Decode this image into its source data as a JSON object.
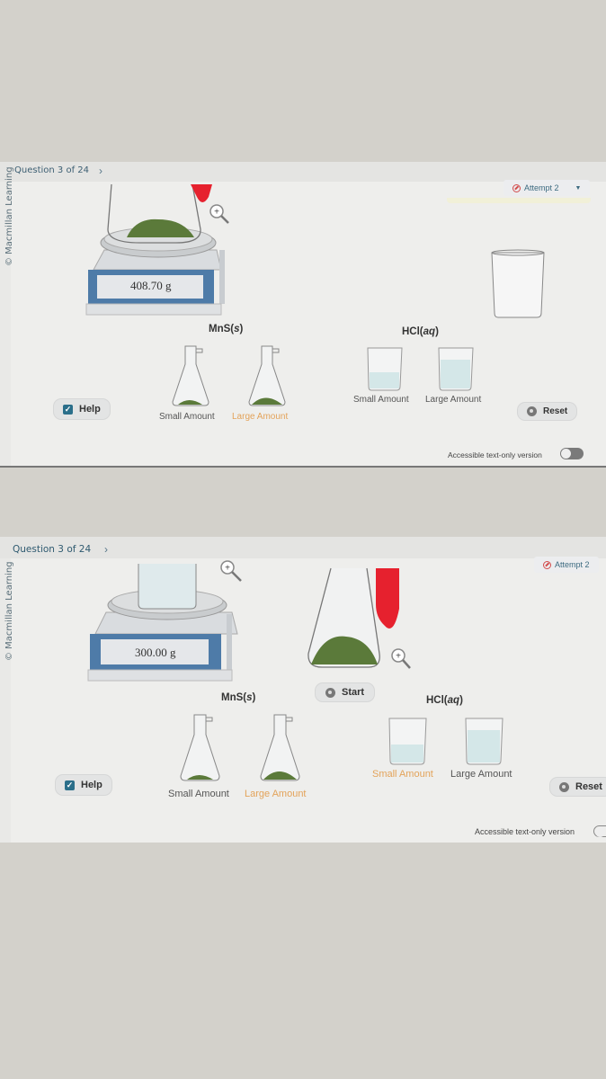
{
  "screenshots": [
    {
      "question_nav": {
        "label": "Question 3 of 24",
        "next_icon": "chevron-right-icon"
      },
      "copyright": "© Macmillan Learning",
      "attempt": {
        "label": "Attempt 2",
        "icon": "no-entry-icon",
        "dropdown_icon": "caret-down-icon"
      },
      "balance": {
        "reading": "408.70 g",
        "contents": "MnS(s) in flask"
      },
      "mns": {
        "title_main": "MnS(",
        "title_state": "s",
        "title_close": ")",
        "options": [
          "Small Amount",
          "Large Amount"
        ],
        "selected": "Large Amount"
      },
      "hcl": {
        "title_main": "HCl(",
        "title_state": "aq",
        "title_close": ")",
        "options": [
          "Small Amount",
          "Large Amount"
        ],
        "selected": null
      },
      "help": {
        "label": "Help",
        "checked": true
      },
      "reset": {
        "label": "Reset"
      },
      "accessible": {
        "label": "Accessible text-only version",
        "enabled": false
      }
    },
    {
      "question_nav": {
        "label": "Question 3 of 24",
        "next_icon": "chevron-right-icon"
      },
      "copyright": "© Macmillan Learning",
      "attempt": {
        "label": "Attempt 2",
        "icon": "no-entry-icon"
      },
      "balance": {
        "reading": "300.00 g",
        "contents": "HCl(aq) in beaker"
      },
      "start": {
        "label": "Start"
      },
      "mns": {
        "title_main": "MnS(",
        "title_state": "s",
        "title_close": ")",
        "options": [
          "Small Amount",
          "Large Amount"
        ],
        "selected": "Large Amount"
      },
      "hcl": {
        "title_main": "HCl(",
        "title_state": "aq",
        "title_close": ")",
        "options": [
          "Small Amount",
          "Large Amount"
        ],
        "selected": "Small Amount"
      },
      "help": {
        "label": "Help",
        "checked": true
      },
      "reset": {
        "label": "Reset"
      },
      "accessible": {
        "label": "Accessible text-only version",
        "enabled": false
      }
    }
  ],
  "colors": {
    "accent_selected": "#e3a35a",
    "nav_text": "#3d5f73",
    "help_check": "#2b6f8a",
    "powder": "#5b7a3a",
    "red_tube": "#e6212e"
  }
}
